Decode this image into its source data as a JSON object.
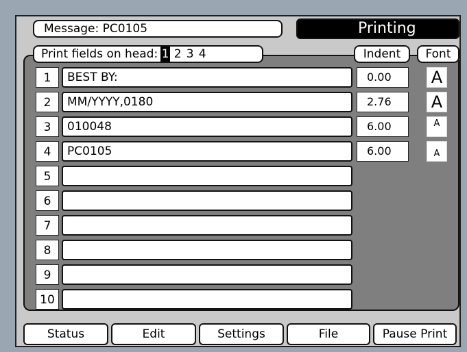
{
  "header": {
    "message_label": "Message: PC0105",
    "status": "Printing"
  },
  "fields_bar": {
    "label": "Print fields on head:",
    "heads": [
      "1",
      "2",
      "3",
      "4"
    ],
    "selected_head": "1",
    "indent_header": "Indent",
    "font_header": "Font"
  },
  "rows": [
    {
      "num": "1",
      "text": "BEST BY:",
      "indent": "0.00",
      "font": "A"
    },
    {
      "num": "2",
      "text": "MM/YYYY,0180",
      "indent": "2.76",
      "font": "A"
    },
    {
      "num": "3",
      "text": "010048",
      "indent": "6.00",
      "font": "A"
    },
    {
      "num": "4",
      "text": "PC0105",
      "indent": "6.00",
      "font": "A"
    },
    {
      "num": "5",
      "text": ""
    },
    {
      "num": "6",
      "text": ""
    },
    {
      "num": "7",
      "text": ""
    },
    {
      "num": "8",
      "text": ""
    },
    {
      "num": "9",
      "text": ""
    },
    {
      "num": "10",
      "text": ""
    }
  ],
  "softkeys": [
    "Status",
    "Edit",
    "Settings",
    "File",
    "Pause Print"
  ]
}
